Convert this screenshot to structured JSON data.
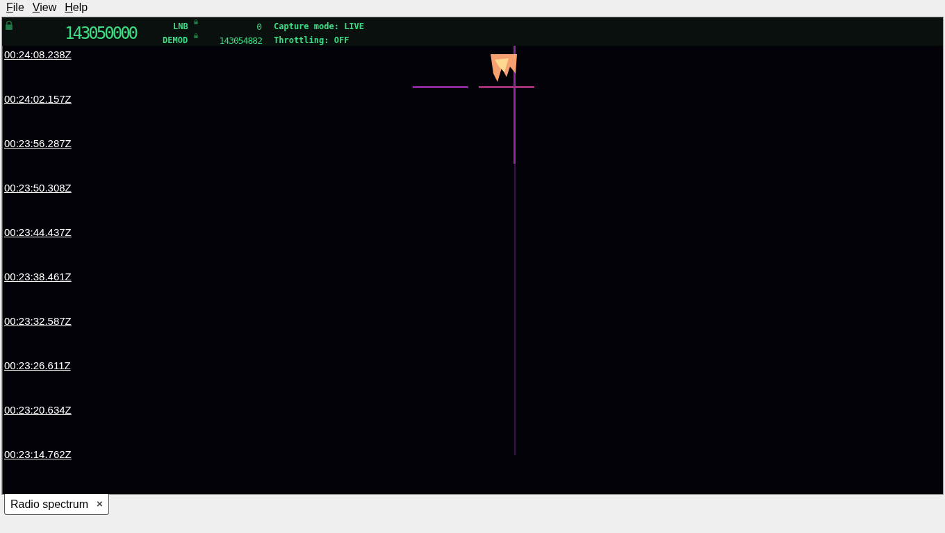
{
  "menu": [
    {
      "label": "File"
    },
    {
      "label": "View"
    },
    {
      "label": "Help"
    }
  ],
  "header": {
    "locked": true,
    "frequency": "143050000",
    "lnb_label": "LNB",
    "lnb_value": "0",
    "demod_label": "DEMOD",
    "demod_value": "143054882",
    "capture_mode": "Capture mode: LIVE",
    "throttling": "Throttling: OFF"
  },
  "timestamps": [
    "00:24:08.238Z",
    "00:24:02.157Z",
    "00:23:56.287Z",
    "00:23:50.308Z",
    "00:23:44.437Z",
    "00:23:38.461Z",
    "00:23:32.587Z",
    "00:23:26.611Z",
    "00:23:20.634Z",
    "00:23:14.762Z"
  ],
  "tabs": [
    {
      "label": "Radio spectrum",
      "close": "×",
      "selected": true
    }
  ]
}
